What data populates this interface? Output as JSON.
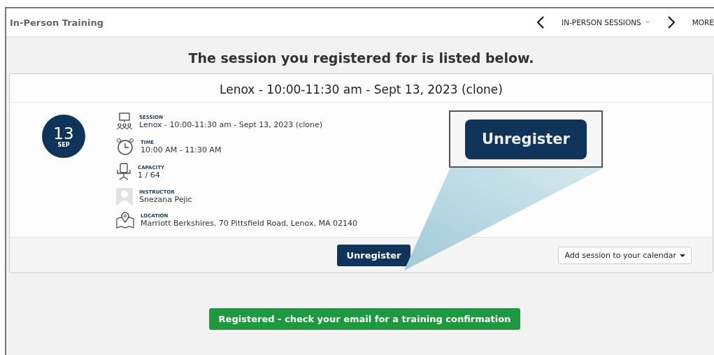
{
  "header": {
    "title": "In-Person Training",
    "nav_label": "IN-PERSON SESSIONS",
    "more_label": "MORE"
  },
  "heading": "The session you registered for is listed below.",
  "session_card": {
    "title": "Lenox - 10:00-11:30 am - Sept 13, 2023 (clone)",
    "date_day": "13",
    "date_month": "SEP",
    "details": [
      {
        "kind": "session",
        "label": "SESSION",
        "value": "Lenox - 10:00-11:30 am - Sept 13, 2023 (clone)"
      },
      {
        "kind": "time",
        "label": "TIME",
        "value": "10:00 AM - 11:30 AM"
      },
      {
        "kind": "capacity",
        "label": "CAPACITY",
        "value": "1 / 64"
      },
      {
        "kind": "instructor",
        "label": "INSTRUCTOR",
        "value": "Snezana Pejic"
      },
      {
        "kind": "location",
        "label": "LOCATION",
        "value": "Marriott Berkshires, 70 Pittsfield Road, Lenox, MA 02140"
      }
    ],
    "unregister_button": "Unregister",
    "calendar_button": "Add session to your calendar"
  },
  "callout": {
    "button_label": "Unregister"
  },
  "status_banner": "Registered - check your email for a training confirmation"
}
